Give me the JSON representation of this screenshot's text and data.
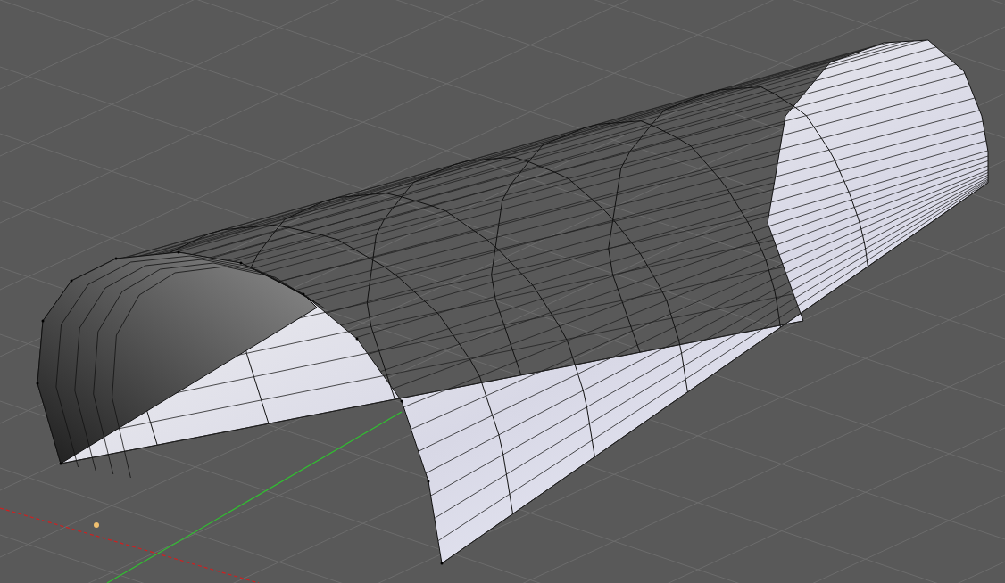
{
  "viewport": {
    "grid": true,
    "x_axis": true,
    "y_axis": true,
    "origin": true
  }
}
